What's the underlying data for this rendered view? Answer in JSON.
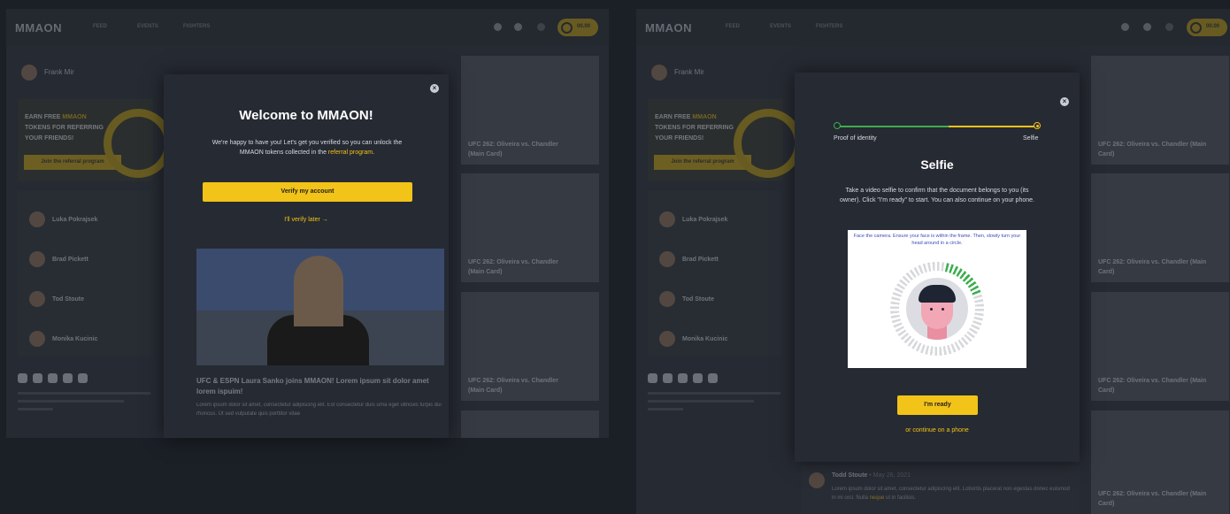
{
  "app": {
    "logo": "MMAON",
    "nav": [
      "FEED",
      "EVENTS",
      "FIGHTERS"
    ],
    "balance": "00.00"
  },
  "sidebar": {
    "user": "Frank Mir",
    "referral_text_1": "EARN FREE ",
    "referral_token_word": "MMAON",
    "referral_text_2": " TOKENS FOR REFERRING YOUR FRIENDS!",
    "referral_button": "Join the referral program",
    "friends": [
      "Luka Pokrajsek",
      "Brad Pickett",
      "Tod Stoute",
      "Monika Kucinic"
    ]
  },
  "media_cards": [
    "UFC 262: Oliveira vs. Chandler (Main Card)",
    "UFC 262: Oliveira vs. Chandler (Main Card)",
    "UFC 262: Oliveira vs. Chandler (Main Card)",
    "UFC 262: Oliveira vs. Chandler (Main Card)"
  ],
  "welcome_modal": {
    "title": "Welcome to MMAON!",
    "text": "We're happy to have you! Let's get you verified so you can unlock the MMAON tokens collected in the ",
    "link": "referral program",
    "text_end": ".",
    "primary_button": "Verify my account",
    "secondary_link": "I'll verify later",
    "arrow": "→"
  },
  "news": {
    "title": "UFC & ESPN Laura Sanko joins MMAON! Lorem ipsum sit dolor amet lorem ispuim!",
    "body": "Lorem ipsum dolor sit amet, consectetur adipiscing elit. Est consectetur duis urna eget ultricies turpis dui rhoncus. Ut sed vulputate quis porttitor vitae"
  },
  "selfie_modal": {
    "step1": "Proof of identity",
    "step2": "Selfie",
    "title": "Selfie",
    "text": "Take a video selfie to confirm that the document belongs to you (its owner). Click \"I'm ready\" to start. You can also continue on your phone.",
    "camera_hint": "Face the camera. Ensure your face is within the frame. Then, slowly turn your head around in a circle.",
    "primary_button": "I'm ready",
    "secondary_link": "or continue on a phone"
  },
  "comment": {
    "author": "Todd Stoute",
    "date": "• May 26, 2021",
    "body_1": "Lorem ipsum dolor sit amet, consectetur adipiscing elit. Lobortis placerat non egestas donec euismod in mi orci. Nulla ",
    "body_link": "neque",
    "body_2": " ut in facilisis."
  },
  "colors": {
    "accent": "#f2c318",
    "progress_green": "#3cae4e",
    "bg": "#262a32"
  }
}
